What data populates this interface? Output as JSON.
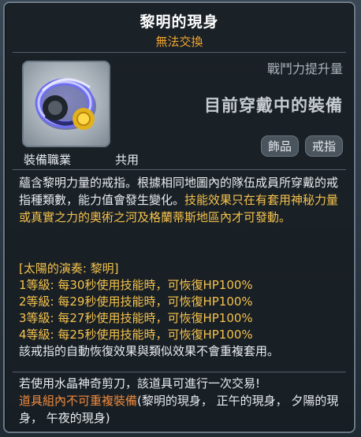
{
  "item": {
    "name": "黎明的現身",
    "trade_status": "無法交換",
    "icon": "ring-icon",
    "power_increase_label": "戰鬥力提升量",
    "equipped_label": "目前穿戴中的裝備",
    "job_label": "裝備職業",
    "job_value": "共用",
    "tags": [
      "飾品",
      "戒指"
    ]
  },
  "description": {
    "part1": "蘊含黎明力量的戒指。根據相同地圖內的隊伍成員所穿戴的戒指種類數，能力值會發生變化。",
    "part2": "技能效果只在有套用神秘力量或真實之力的奧術之河及格蘭蒂斯地區內才可發動。"
  },
  "set_effect": {
    "header": "[太陽的演奏: 黎明]",
    "levels": [
      "1等級: 每30秒使用技能時，可恢復HP100%",
      "2等級: 每29秒使用技能時，可恢復HP100%",
      "3等級: 每27秒使用技能時，可恢復HP100%",
      "4等級: 每25秒使用技能時，可恢復HP100%"
    ],
    "note": "該戒指的自動恢復效果與類似效果不會重複套用。"
  },
  "footer": {
    "scissor_note": "若使用水晶神奇剪刀，該道具可進行一次交易!",
    "no_dup_label": "道具組內不可重複裝備",
    "no_dup_items": "(黎明的現身， 正午的現身， 夕陽的現身， 午夜的現身)"
  },
  "colors": {
    "title": "#ffffff",
    "trade_status": "#f2a630",
    "highlight": "#f5c24c",
    "warning": "#f08a3c",
    "body_text": "#e9ecef",
    "tooltip_bg": "#181e24"
  }
}
